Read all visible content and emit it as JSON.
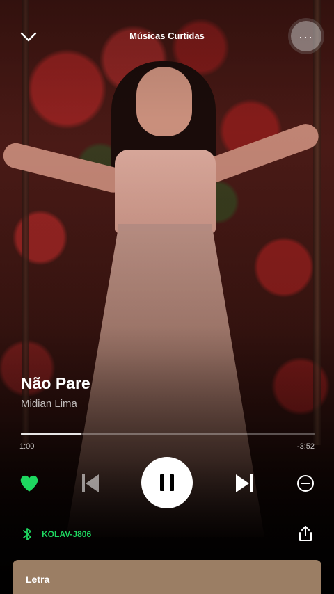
{
  "header": {
    "title": "Músicas Curtidas",
    "collapse_icon": "chevron-down-icon",
    "menu_icon": "more-options-icon",
    "menu_label": "..."
  },
  "track": {
    "title": "Não Pare",
    "artist": "Midian Lima"
  },
  "progress": {
    "elapsed": "1:00",
    "remaining": "-3:52",
    "fraction": 0.205
  },
  "controls": {
    "like_icon": "heart-filled-icon",
    "previous_icon": "skip-previous-icon",
    "play_pause_icon": "pause-icon",
    "next_icon": "skip-next-icon",
    "remove_icon": "minus-circle-icon",
    "liked": true
  },
  "device": {
    "icon": "bluetooth-icon",
    "name": "KOLAV-J806",
    "share_icon": "share-icon"
  },
  "lyrics": {
    "label": "Letra"
  },
  "colors": {
    "accent_green": "#1ed760",
    "lyrics_card": "#9b7e64",
    "background": "#000000"
  }
}
